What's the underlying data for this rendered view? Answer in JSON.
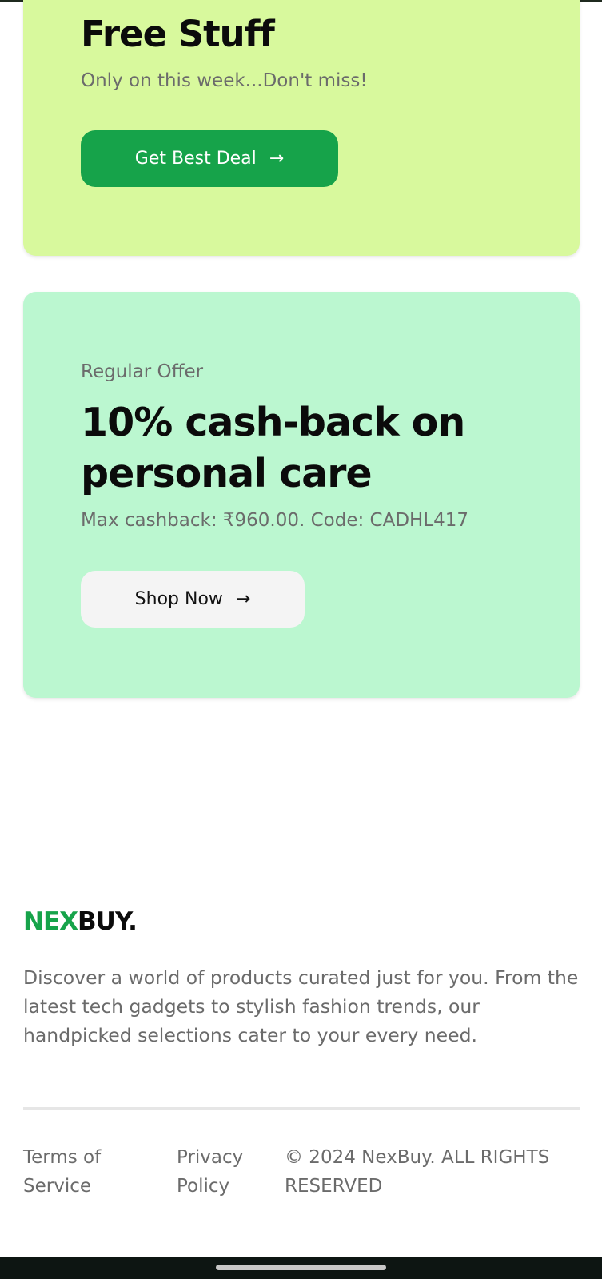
{
  "promo_card": {
    "title": "Free Stuff",
    "subtitle": "Only on this week...Don't miss!",
    "button_label": "Get Best Deal",
    "button_icon": "arrow-right-icon",
    "background": "#d8f99d",
    "button_color": "#16a34a"
  },
  "offer_card": {
    "eyebrow": "Regular Offer",
    "title": "10% cash-back on personal care",
    "details": "Max cashback: ₹960.00. Code: CADHL417",
    "button_label": "Shop Now",
    "button_icon": "arrow-right-icon",
    "background": "#bbf7d0"
  },
  "footer": {
    "logo_primary": "NEX",
    "logo_secondary": "BUY.",
    "description": "Discover a world of products curated just for you. From the latest tech gadgets to stylish fashion trends, our handpicked selections cater to your every need.",
    "links": {
      "terms": "Terms of Service",
      "privacy": "Privacy Policy"
    },
    "copyright": "© 2024 NexBuy. ALL RIGHTS RESERVED"
  },
  "colors": {
    "accent": "#16a34a",
    "text_muted": "#6b6b6b"
  }
}
